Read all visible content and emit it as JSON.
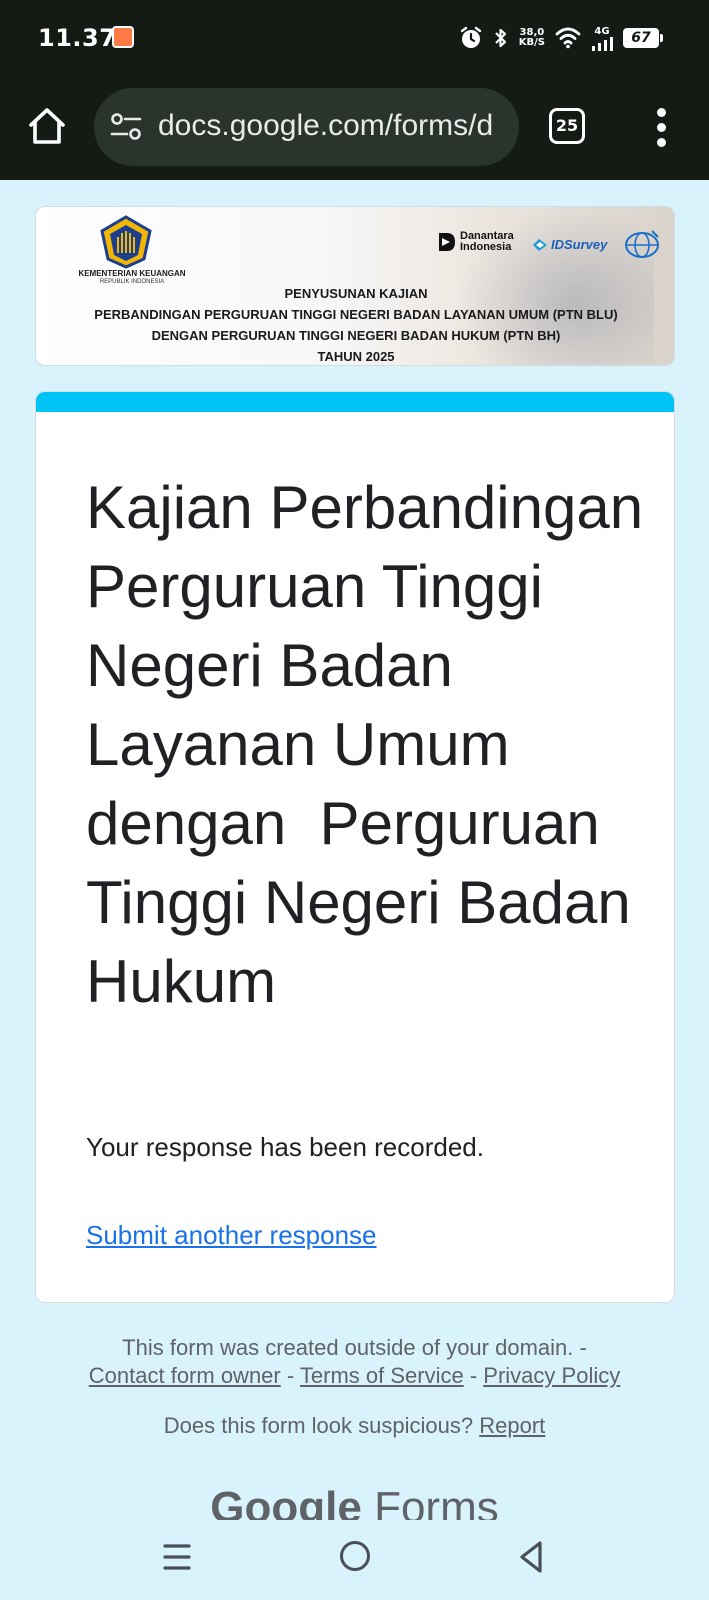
{
  "status_bar": {
    "time": "11.37",
    "speed_value": "38,0",
    "speed_unit": "KB/S",
    "network": "4G",
    "battery": "67",
    "icons": [
      "app-notification-icon",
      "alarm-icon",
      "bluetooth-icon",
      "wifi-icon",
      "signal-icon",
      "battery-icon"
    ]
  },
  "browser": {
    "url": "docs.google.com/forms/d",
    "tab_count": "25",
    "icons": [
      "home-icon",
      "site-settings-icon",
      "tabs-icon",
      "overflow-menu-icon"
    ]
  },
  "banner": {
    "agency_name": "KEMENTERIAN KEUANGAN",
    "agency_sub": "REPUBLIK INDONESIA",
    "partner_1_line1": "Danantara",
    "partner_1_line2": "Indonesia",
    "partner_2": "IDSurvey",
    "line1": "PENYUSUNAN KAJIAN",
    "line2": "PERBANDINGAN PERGURUAN TINGGI NEGERI BADAN LAYANAN UMUM (PTN BLU)",
    "line3": "DENGAN PERGURUAN TINGGI NEGERI BADAN HUKUM (PTN BH)",
    "line4": "TAHUN 2025"
  },
  "form": {
    "title": "Kajian Perbandingan Perguruan Tinggi Negeri Badan Layanan Umum dengan  Perguruan Tinggi Negeri Badan Hukum",
    "confirmation": "Your response has been recorded.",
    "submit_another": "Submit another response",
    "accent_color": "#00c3f5"
  },
  "footer": {
    "notice": "This form was created outside of your domain. -",
    "contact_owner": "Contact form owner",
    "terms": "Terms of Service",
    "privacy": "Privacy Policy",
    "separator": " - ",
    "suspicious": "Does this form look suspicious?",
    "report": "Report",
    "brand_google": "Google",
    "brand_forms": "Forms"
  },
  "nav_bar": {
    "icons": [
      "recent-apps-icon",
      "home-circle-icon",
      "back-icon"
    ]
  }
}
